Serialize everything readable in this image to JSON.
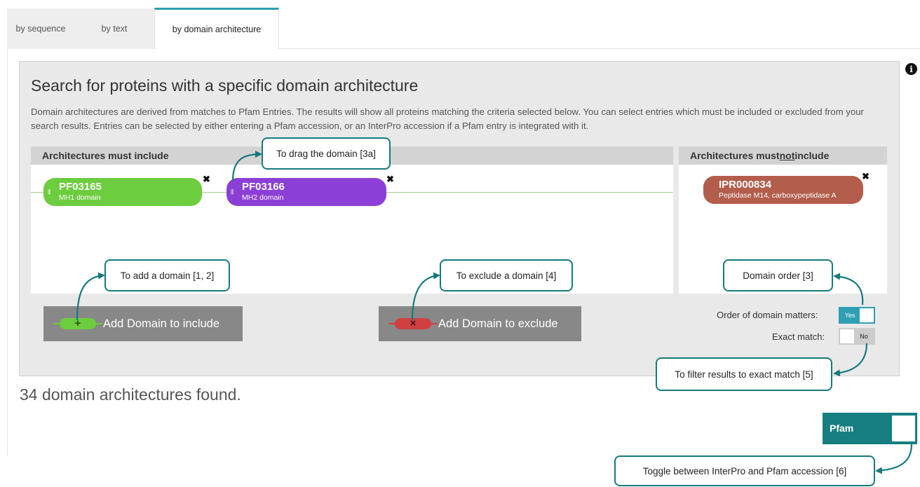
{
  "tabs": [
    {
      "label": "by sequence"
    },
    {
      "label": "by text"
    },
    {
      "label": "by domain architecture"
    }
  ],
  "info_icon": {
    "glyph": "i"
  },
  "panel": {
    "title": "Search for proteins with a specific domain architecture",
    "description": "Domain architectures are derived from matches to Pfam Entries. The results will show all proteins matching the criteria selected below. You can select entries which must be included or excluded from your search results. Entries can be selected by either entering a Pfam accession, or an InterPro accession if a Pfam entry is integrated with it."
  },
  "include": {
    "header": "Architectures must include",
    "domains": [
      {
        "accession": "PF03165",
        "name": "MH1 domain",
        "color": "#6ccd3f"
      },
      {
        "accession": "PF03166",
        "name": "MH2 domain",
        "color": "#8c3fd6"
      }
    ],
    "add_button": "Add Domain to include",
    "add_symbol": "+"
  },
  "exclude": {
    "header_prefix": "Architectures must ",
    "header_emph": "not",
    "header_suffix": " include",
    "domains": [
      {
        "accession": "IPR000834",
        "name": "Peptidase M14, carboxypeptidase A",
        "color": "#b35d4c"
      }
    ],
    "add_button": "Add Domain to exclude",
    "add_symbol": "×"
  },
  "close_glyph": "✖",
  "grip_glyph": "|||",
  "options": {
    "order_label": "Order of domain matters:",
    "order_value": "Yes",
    "exact_label": "Exact match:",
    "exact_value": "No"
  },
  "callouts": {
    "drag": "To drag the domain [3a]",
    "add": "To add a domain [1, 2]",
    "exclude": "To exclude a domain [4]",
    "order": "Domain order [3]",
    "exact": "To filter results to exact match [5]",
    "toggle": "Toggle between InterPro and Pfam accession [6]"
  },
  "results": {
    "text": "34 domain architectures found."
  },
  "pfam_toggle": {
    "label": "Pfam"
  },
  "colors": {
    "accent": "#2f9fb3",
    "callout": "#16797c",
    "pfam": "#167e80"
  }
}
